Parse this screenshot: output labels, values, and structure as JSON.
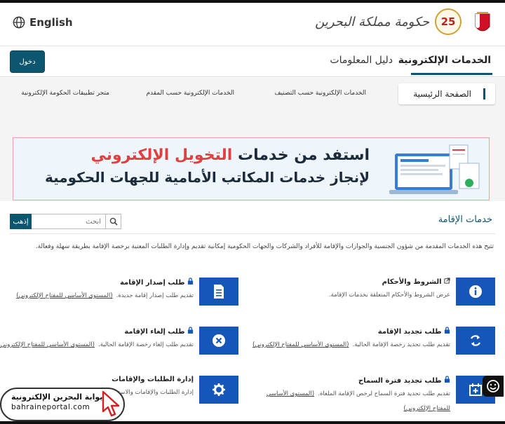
{
  "header": {
    "language_label": "English",
    "logo_text": "حكومة مملكة البحرين",
    "anniversary_badge": "25"
  },
  "nav": {
    "login_label": "دخول",
    "tabs": [
      {
        "label": "الخدمات الإلكترونية",
        "active": true
      },
      {
        "label": "دليل المعلومات",
        "active": false
      }
    ]
  },
  "subnav": {
    "items": [
      {
        "label": "الصفحة الرئيسية",
        "active": true
      },
      {
        "label": "الخدمات الإلكترونية حسب التصنيف"
      },
      {
        "label": "الخدمات الإلكترونية حسب المقدم"
      },
      {
        "label": "متجر تطبيقات الحكومة الإلكترونية"
      }
    ]
  },
  "banner": {
    "line1_prefix": "استفد من خدمات ",
    "line1_highlight": "التخويل الإلكتروني",
    "line2": "لإنجاز خدمات المكاتب الأمامية للجهات الحكومية"
  },
  "search": {
    "go_label": "إذهب",
    "placeholder": "ابحث"
  },
  "section": {
    "title": "خدمات الإقامة",
    "description": "تتيح هذه الخدمات المقدمة من شؤون الجنسية والجوازات والإقامة للأفراد والشركات والجهات الحكومية إمكانية تقديم وإدارة الطلبات المعنية برخصة الإقامة بطريقة سهلة وفعالة."
  },
  "services": [
    {
      "title": "الشروط والأحكام",
      "description": "عرض الشروط والأحكام المتعلقة بخدمات الإقامة.",
      "link": "",
      "icon": "info-icon",
      "locked": false
    },
    {
      "title": "طلب إصدار الإقامة",
      "description": "تقديم طلب إصدار إقامة جديدة.",
      "link": "(المستوى الأساسي للمفتاح الإلكتروني)",
      "icon": "document-icon",
      "locked": true
    },
    {
      "title": "طلب تجديد الإقامة",
      "description": "تقديم طلب تجديد رخصة الإقامة الحالية.",
      "link": "(المستوى الأساسي للمفتاح الإلكتروني)",
      "icon": "refresh-icon",
      "locked": true
    },
    {
      "title": "طلب إلغاء الإقامة",
      "description": "تقديم طلب إلغاء رخصة الإقامة الحالية.",
      "link": "(المستوى الأساسي للمفتاح الإلكتروني)",
      "icon": "cancel-icon",
      "locked": true
    },
    {
      "title": "طلب تجديد فترة السماح",
      "description": "تقديم طلب تجديد فترة السماح لرخص الإقامة الملغاة.",
      "link": "(المستوى الأساسي للمفتاح الإلكتروني)",
      "icon": "calendar-add-icon",
      "locked": true
    },
    {
      "title": "إدارة الطلبات والإقامات",
      "description": "إدارة الطلبات والإقامات والاستعلام",
      "link": "",
      "icon": "gear-icon",
      "locked": false
    }
  ],
  "overlay": {
    "portal_name": "بوابة البحرين الإلكترونية",
    "portal_url": "bahraineportal.com"
  },
  "colors": {
    "primary": "#0d5670",
    "service_icon_bg": "#1557b8",
    "banner_highlight": "#e04040"
  }
}
